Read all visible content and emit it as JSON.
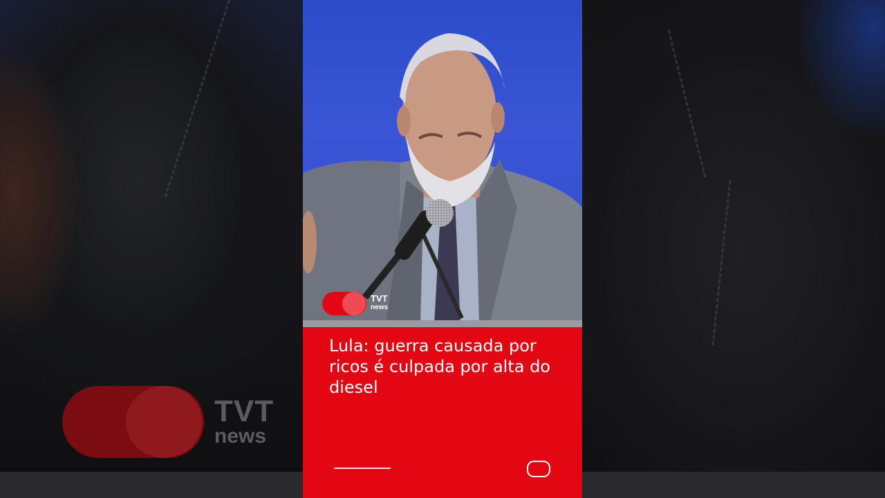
{
  "video": {
    "headline": "Lula: guerra causada por ricos é culpada por alta do diesel",
    "brand": {
      "line1": "TVT",
      "line2": "news"
    }
  },
  "background_logo": {
    "line1": "TVT",
    "line2": "news"
  },
  "colors": {
    "brand_red": "#e30613",
    "stage_blue": "#2f4ccd",
    "text": "#ffffff"
  },
  "controls": {
    "progress_fraction": 0.2
  }
}
